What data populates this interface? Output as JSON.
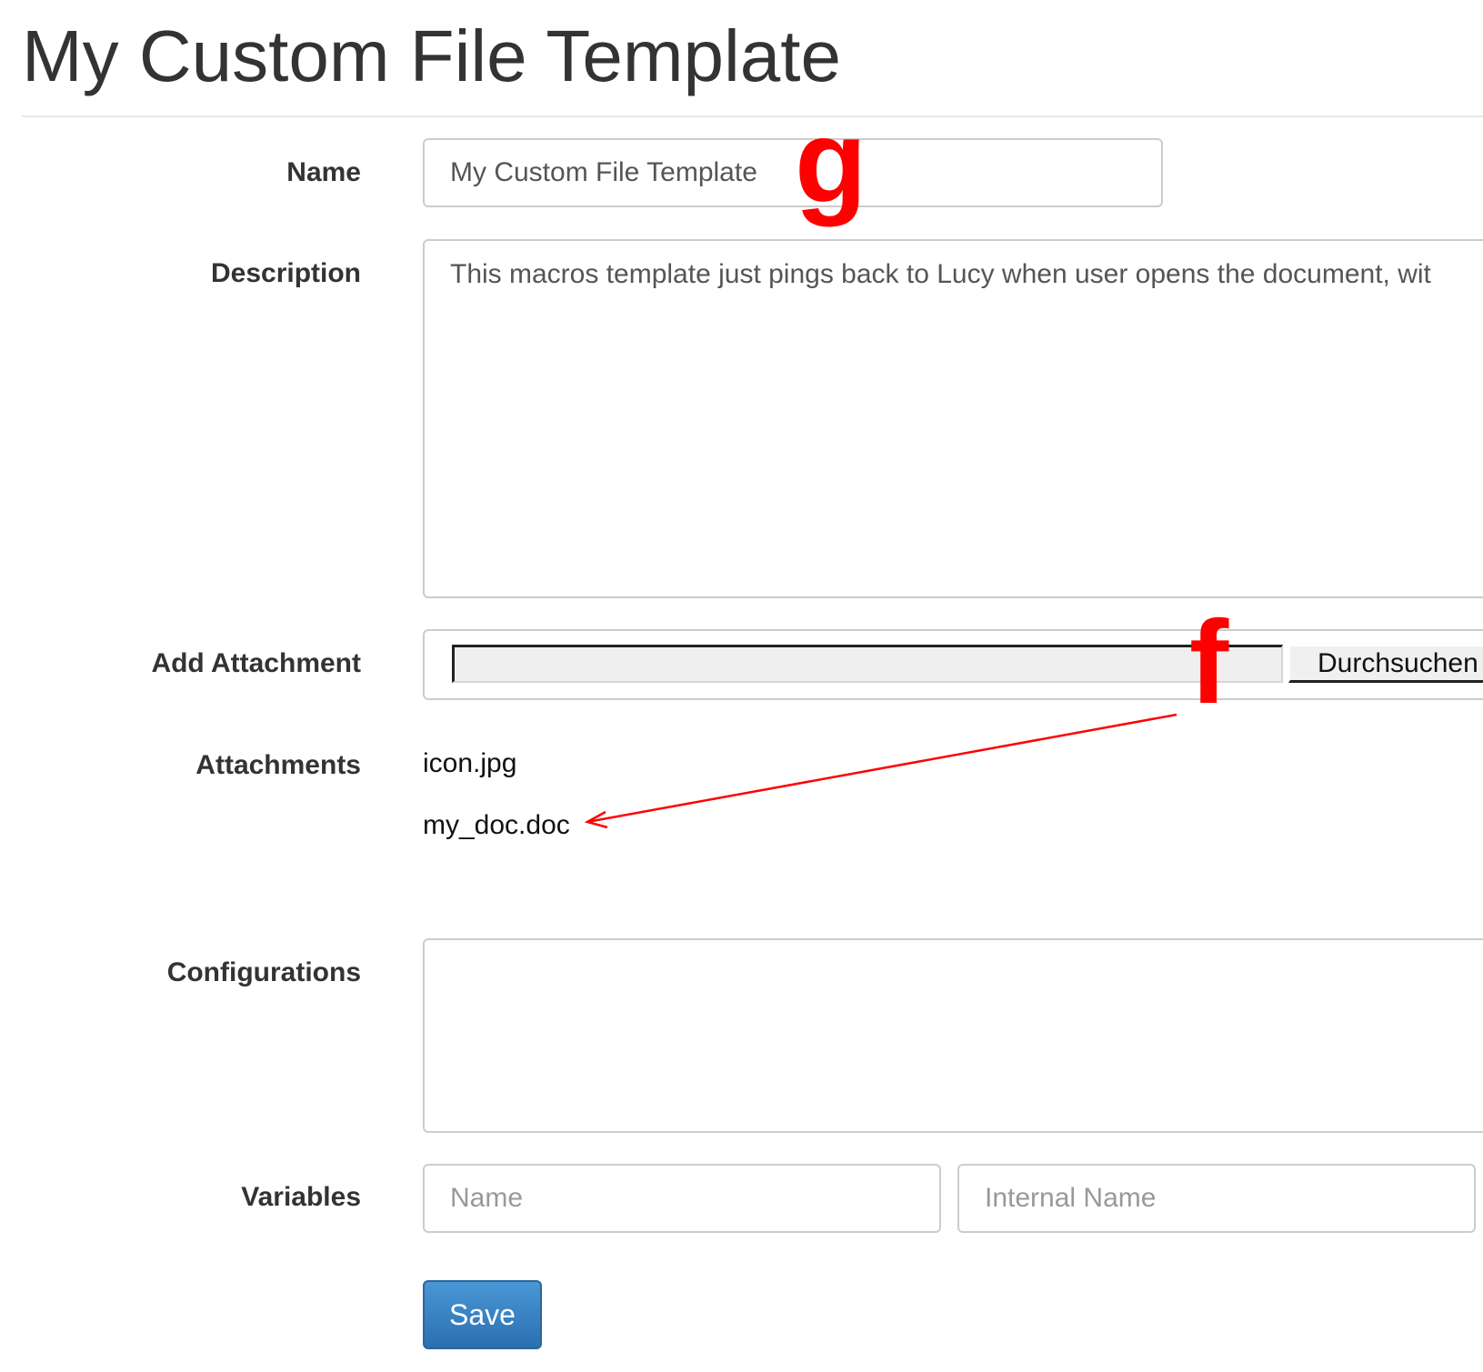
{
  "page": {
    "title": "My Custom File Template"
  },
  "form": {
    "name": {
      "label": "Name",
      "value": "My Custom File Template"
    },
    "description": {
      "label": "Description",
      "value": "This macros template just pings back to Lucy when user opens the document, wit"
    },
    "add_attachment": {
      "label": "Add Attachment",
      "browse_label": "Durchsuchen"
    },
    "attachments": {
      "label": "Attachments",
      "items": [
        "icon.jpg",
        "my_doc.doc"
      ]
    },
    "configurations": {
      "label": "Configurations",
      "value": ""
    },
    "variables": {
      "label": "Variables",
      "name_placeholder": "Name",
      "internal_name_placeholder": "Internal Name"
    },
    "save_label": "Save"
  },
  "annotations": {
    "letter_g": "g",
    "letter_f": "f",
    "color": "#ff0000"
  },
  "colors": {
    "primary_button": "#337ab7",
    "input_border": "#cccccc",
    "text": "#333333"
  }
}
